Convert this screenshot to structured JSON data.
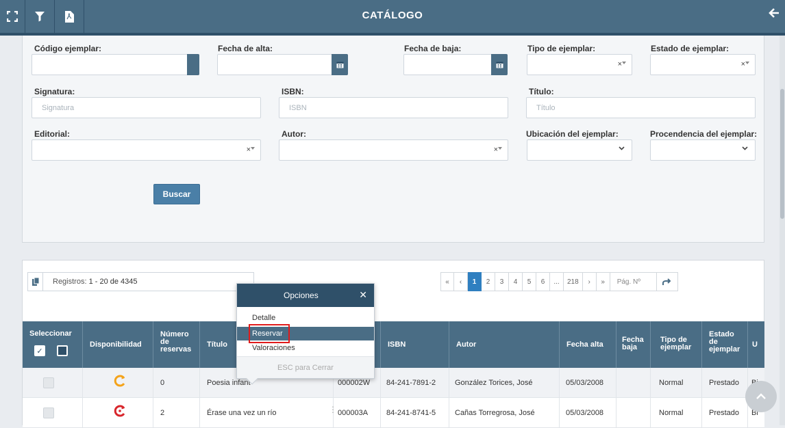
{
  "header": {
    "title": "CATÁLOGO"
  },
  "filters": {
    "codigo_label": "Código ejemplar:",
    "fecha_alta_label": "Fecha de alta:",
    "fecha_baja_label": "Fecha de baja:",
    "tipo_label": "Tipo de ejemplar:",
    "estado_label": "Estado de ejemplar:",
    "signatura_label": "Signatura:",
    "signatura_placeholder": "Signatura",
    "isbn_label": "ISBN:",
    "isbn_placeholder": "ISBN",
    "titulo_label": "Título:",
    "titulo_placeholder": "Título",
    "editorial_label": "Editorial:",
    "autor_label": "Autor:",
    "ubicacion_label": "Ubicación del ejemplar:",
    "procedencia_label": "Procendencia del ejemplar:",
    "buscar_label": "Buscar",
    "clear_symbol": "×"
  },
  "registros": {
    "prefix": "Registros: ",
    "range": "1 - 20 de 4345"
  },
  "pagination": {
    "first": "«",
    "prev": "‹",
    "pages": [
      "1",
      "2",
      "3",
      "4",
      "5",
      "6",
      "...",
      "218"
    ],
    "next": "›",
    "last": "»",
    "page_placeholder": "Pág. Nº"
  },
  "table": {
    "headers": {
      "seleccionar": "Seleccionar",
      "disponibilidad": "Disponibilidad",
      "num_reservas": [
        "Número",
        "de",
        "reservas"
      ],
      "titulo": "Título",
      "isbn": "ISBN",
      "autor": "Autor",
      "fecha_alta": "Fecha alta",
      "fecha_baja": [
        "Fecha",
        "baja"
      ],
      "tipo": [
        "Tipo de",
        "ejemplar"
      ],
      "estado": [
        "Estado",
        "de",
        "ejemplar"
      ],
      "last": "U"
    },
    "rows": [
      {
        "availability": "available",
        "num_reservas": "0",
        "titulo": "Poesia infant",
        "codigo": "000002W",
        "isbn": "84-241-7891-2",
        "autor": "González Torices, José",
        "fecha_alta": "05/03/2008",
        "fecha_baja": "",
        "tipo": "Normal",
        "estado": "Prestado",
        "extra": "Bi"
      },
      {
        "availability": "reserved",
        "num_reservas": "2",
        "titulo": "Érase una vez un río",
        "codigo": "000003A",
        "isbn": "84-241-8741-5",
        "autor": "Cañas Torregrosa, José",
        "fecha_alta": "05/03/2008",
        "fecha_baja": "",
        "tipo": "Normal",
        "estado": "Prestado",
        "extra": "Bi"
      }
    ]
  },
  "options_popup": {
    "title": "Opciones",
    "items": [
      "Detalle",
      "Reservar",
      "Valoraciones"
    ],
    "selected": "Reservar",
    "footer": "ESC para Cerrar"
  },
  "colors": {
    "header": "#4a6d85",
    "accent": "#2f7fc0",
    "available": "#f4a31a",
    "reserved": "#d8262c",
    "highlight": "#e01b1b"
  }
}
